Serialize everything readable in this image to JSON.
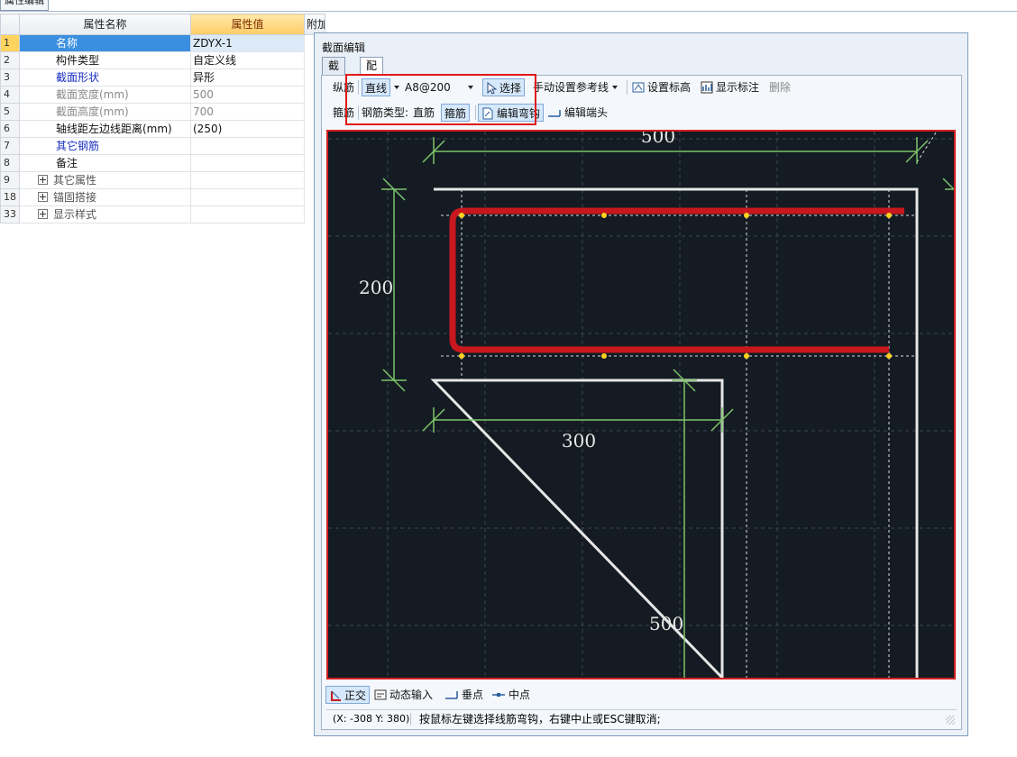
{
  "top_tab": "属性编辑",
  "grid": {
    "header_name": "属性名称",
    "header_value": "属性值",
    "header_extra": "附加",
    "rows": [
      {
        "num": "1",
        "name": "名称",
        "value": "ZDYX-1"
      },
      {
        "num": "2",
        "name": "构件类型",
        "value": "自定义线"
      },
      {
        "num": "3",
        "name": "截面形状",
        "value": "异形"
      },
      {
        "num": "4",
        "name": "截面宽度(mm)",
        "value": "500"
      },
      {
        "num": "5",
        "name": "截面高度(mm)",
        "value": "700"
      },
      {
        "num": "6",
        "name": "轴线距左边线距离(mm)",
        "value": "(250)"
      },
      {
        "num": "7",
        "name": "其它钢筋",
        "value": ""
      },
      {
        "num": "8",
        "name": "备注",
        "value": ""
      },
      {
        "num": "9",
        "name": "其它属性",
        "value": ""
      },
      {
        "num": "18",
        "name": "锚固搭接",
        "value": ""
      },
      {
        "num": "33",
        "name": "显示样式",
        "value": ""
      }
    ]
  },
  "dialog": {
    "title": "截面编辑",
    "tabs": [
      "截面",
      "配筋"
    ],
    "toolbar1": {
      "longitudinal": "纵筋",
      "line_mode": "直线",
      "rebar_spec": "A8@200",
      "select": "选择",
      "manual_ref": "手动设置参考线",
      "set_elevation": "设置标高",
      "show_annotation": "显示标注",
      "delete": "删除"
    },
    "toolbar2": {
      "stirrup": "箍筋",
      "rebar_type_label": "钢筋类型:",
      "straight_bar": "直筋",
      "hoop_bar": "箍筋",
      "edit_hook": "编辑弯钩",
      "edit_end": "编辑端头"
    },
    "dimensions": {
      "top": "500",
      "left": "200",
      "middle": "300",
      "bottom": "500"
    },
    "bottom_toolbar": {
      "ortho": "正交",
      "dynamic_input": "动态输入",
      "perpendicular": "垂点",
      "midpoint": "中点"
    },
    "status": {
      "coords": "(X: -308 Y: 380)",
      "message": "按鼠标左键选择线筋弯钩，右键中止或ESC键取消;"
    }
  },
  "colors": {
    "canvas_bg": "#141b22",
    "rebar": "#c8181e",
    "dimension": "#7cc46a",
    "outline": "#e6e6e6",
    "highlight_box": "#e01919",
    "selected_row": "#3b8fe0"
  }
}
